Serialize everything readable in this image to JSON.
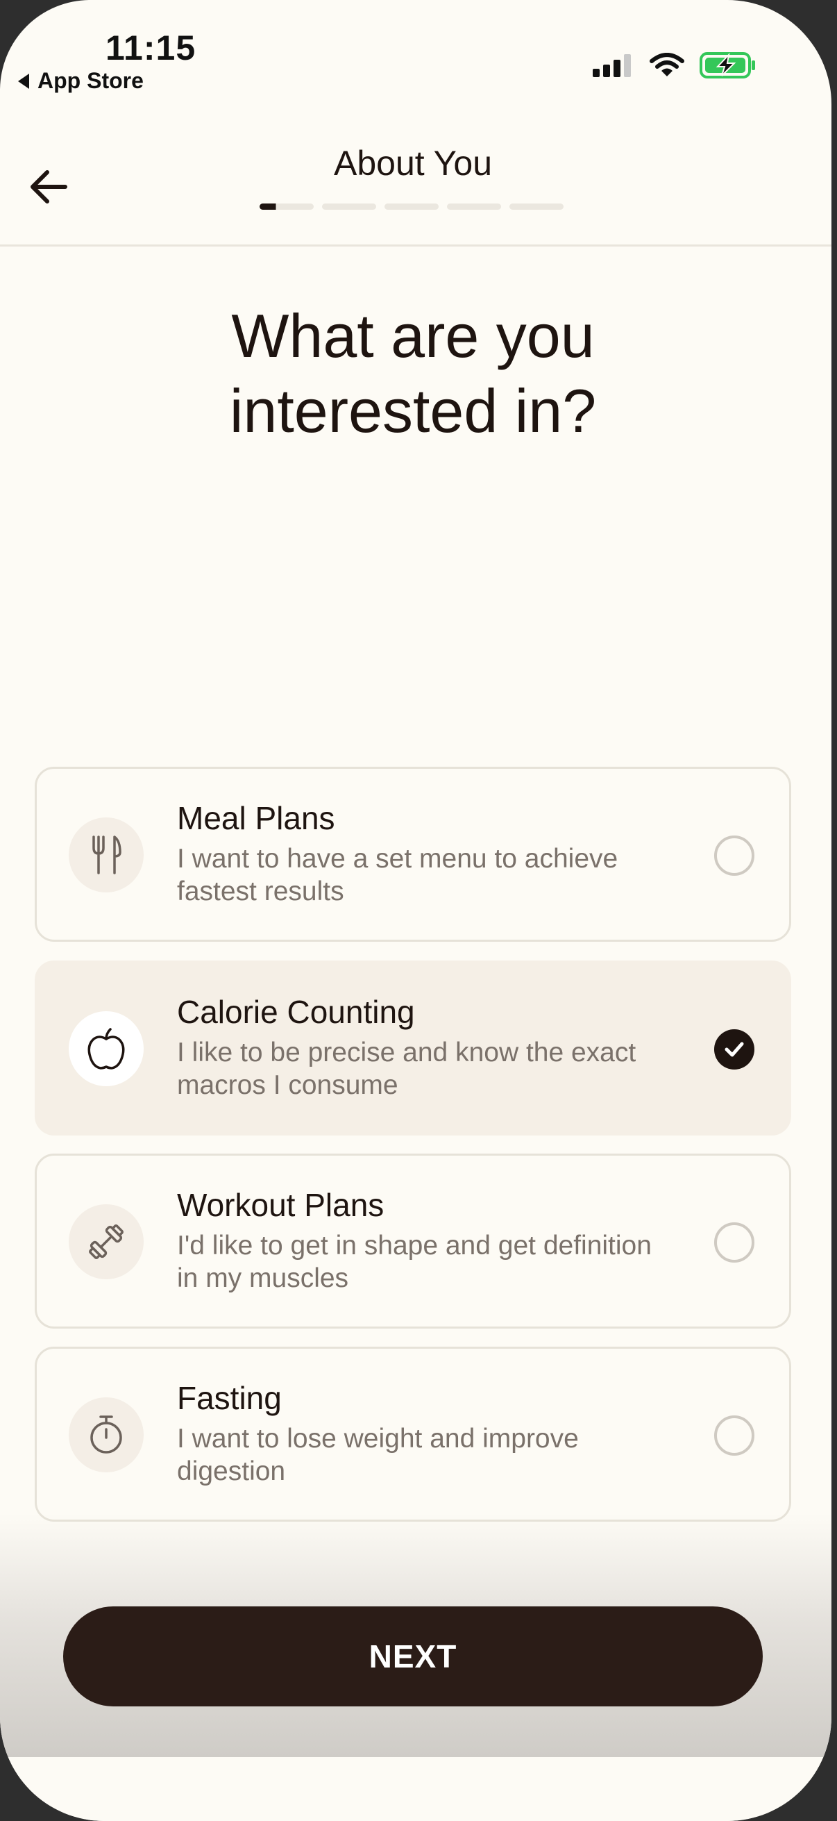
{
  "status_bar": {
    "time": "11:15",
    "back_label": "App Store",
    "battery_color": "#34c759"
  },
  "header": {
    "title": "About You",
    "progress_steps": 5,
    "current_step": 1
  },
  "question": "What are you\ninterested in?",
  "options": [
    {
      "title": "Meal Plans",
      "description": "I want to have a set menu to achieve fastest results",
      "icon": "fork-knife-icon",
      "selected": false
    },
    {
      "title": "Calorie Counting",
      "description": "I like to be precise and know the exact macros I consume",
      "icon": "apple-icon",
      "selected": true
    },
    {
      "title": "Workout Plans",
      "description": "I'd like to get in shape and get definition in my muscles",
      "icon": "dumbbell-icon",
      "selected": false
    },
    {
      "title": "Fasting",
      "description": "I want to lose weight and improve digestion",
      "icon": "stopwatch-icon",
      "selected": false
    }
  ],
  "next_button": {
    "label": "NEXT"
  },
  "colors": {
    "background": "#fdfbf5",
    "primary": "#2b1c17",
    "selected_card": "#f5efe6"
  }
}
